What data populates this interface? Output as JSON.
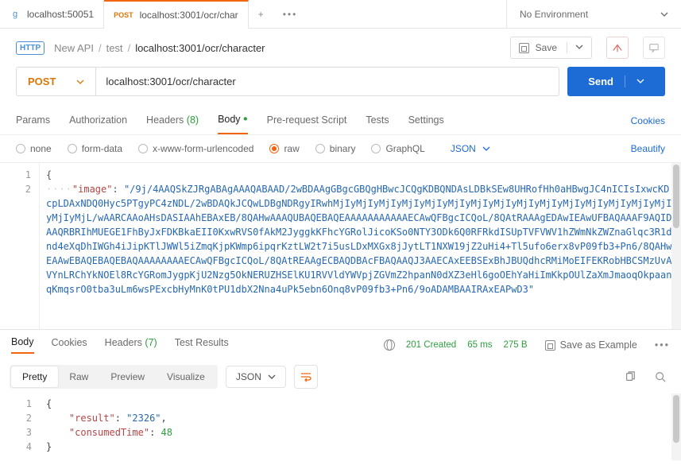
{
  "tabs": [
    {
      "label": "localhost:50051",
      "method": "",
      "icon": "grpc"
    },
    {
      "label": "localhost:3001/ocr/char",
      "method": "POST",
      "active": true
    }
  ],
  "env": {
    "label": "No Environment"
  },
  "breadcrumb": {
    "p1": "New API",
    "p2": "test",
    "p3": "localhost:3001/ocr/character"
  },
  "save_label": "Save",
  "request": {
    "method": "POST",
    "url": "localhost:3001/ocr/character",
    "send_label": "Send"
  },
  "req_tabs": {
    "params": "Params",
    "auth": "Authorization",
    "headers": "Headers",
    "headers_count": "(8)",
    "body": "Body",
    "pre": "Pre-request Script",
    "tests": "Tests",
    "settings": "Settings"
  },
  "cookies_link": "Cookies",
  "body_types": {
    "none": "none",
    "form": "form-data",
    "url": "x-www-form-urlencoded",
    "raw": "raw",
    "binary": "binary",
    "graphql": "GraphQL"
  },
  "json_dd": "JSON",
  "beautify": "Beautify",
  "req_body": {
    "key": "\"image\"",
    "value": "\"/9j/4AAQSkZJRgABAgAAAQABAAD/2wBDAAgGBgcGBQgHBwcJCQgKDBQNDAsLDBkSEw8UHRofHh0aHBwgJC4nICIsIxwcKDcpLDAxNDQ0Hyc5PTgyPC4zNDL/2wBDAQkJCQwLDBgNDRgyIRwhMjIyMjIyMjIyMjIyMjIyMjIyMjIyMjIyMjIyMjIyMjIyMjIyMjIyMjIyMjIyMjIyMjL/wAARCAAoAHsDASIAAhEBAxEB/8QAHwAAAQUBAQEBAQEAAAAAAAAAAAECAwQFBgcICQoL/8QAtRAAAgEDAwIEAwUFBAQAAAF9AQIDAAQRBRIhMUEGE1FhByJxFDKBkaEII0KxwRVS0fAkM2JyggkKFhcYGRolJicoKSo0NTY3ODk6Q0RFRkdISUpTVFVWV1hZWmNkZWZnaGlqc3R1dnd4eXqDhIWGh4iJipKTlJWWl5iZmqKjpKWmp6ipqrKztLW2t7i5usLDxMXGx8jJytLT1NXW19jZ2uHi4+Tl5ufo6erx8vP09fb3+Pn6/8QAHwEAAwEBAQEBAQEBAQAAAAAAAAECAwQFBgcICQoL/8QAtREAAgECBAQDBAcFBAQAAQJ3AAECAxEEBSExBhJBUQdhcRMiMoEIFEKRobHBCSMzUvAVYnLRChYkNOEl8RcYGRomJygpKjU2Nzg5OkNERUZHSElKU1RVVldYWVpjZGVmZ2hpanN0dXZ3eHl6goOEhYaHiImKkpOUlZaXmJmaoqOkpaanqKmqsrO0tba3uLm6wsPExcbHyMnK0tPU1dbX2Nna4uPk5ebn6Onq8vP09fb3+Pn6/9oADAMBAAIRAxEAPwD3\""
  },
  "res_tabs": {
    "body": "Body",
    "cookies": "Cookies",
    "headers": "Headers",
    "headers_count": "(7)",
    "tests": "Test Results"
  },
  "status": {
    "code": "201 Created",
    "time": "65 ms",
    "size": "275 B"
  },
  "save_example": "Save as Example",
  "res_views": {
    "pretty": "Pretty",
    "raw": "Raw",
    "preview": "Preview",
    "visualize": "Visualize"
  },
  "res_json_dd": "JSON",
  "response_body": {
    "result_key": "\"result\"",
    "result_val": "\"2326\"",
    "time_key": "\"consumedTime\"",
    "time_val": "48"
  }
}
